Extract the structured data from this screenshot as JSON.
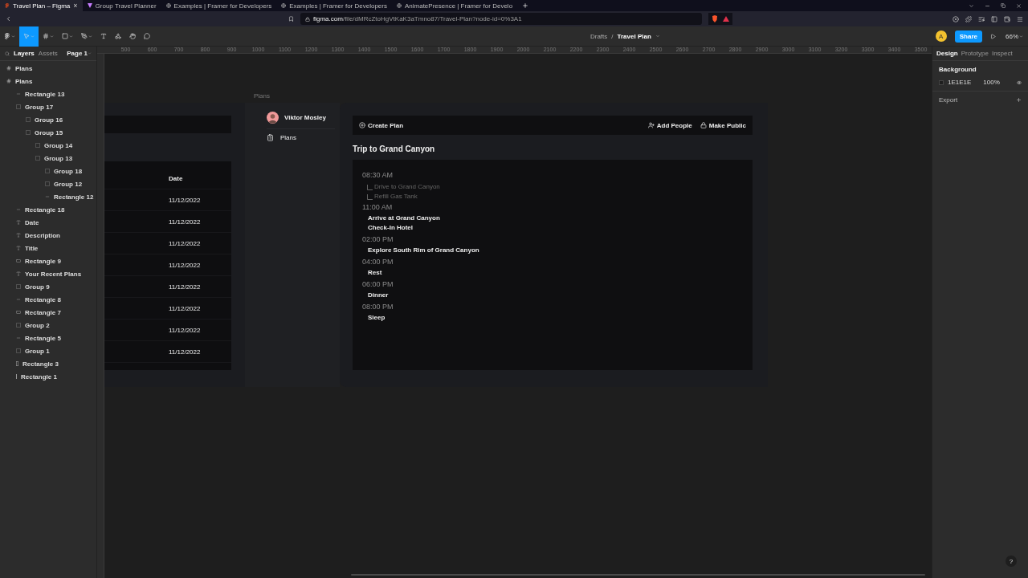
{
  "browser": {
    "tabs": [
      {
        "title": "Travel Plan – Figma",
        "selected": true,
        "close": "×"
      },
      {
        "title": "Group Travel Planner",
        "selected": false
      },
      {
        "title": "Examples | Framer for Developers",
        "selected": false
      },
      {
        "title": "Examples | Framer for Developers",
        "selected": false
      },
      {
        "title": "AnimatePresence | Framer for Develo",
        "selected": false
      }
    ],
    "url_host": "figma.com",
    "url_path": "/file/dMRcZtoHgVtKaK3aTmno87/Travel-Plan?node-id=0%3A1"
  },
  "toolbar": {
    "breadcrumb": "Drafts",
    "separator": "/",
    "file": "Travel Plan",
    "avatar": "A",
    "share": "Share",
    "zoom": "66%"
  },
  "layers_panel": {
    "tabs": [
      {
        "label": "Layers",
        "selected": true
      },
      {
        "label": "Assets",
        "selected": false
      }
    ],
    "page": "Page 1",
    "layers": [
      {
        "name": "Plans",
        "kind": "frame"
      },
      {
        "name": "Plans",
        "kind": "frame",
        "children": [
          {
            "name": "Rectangle 13",
            "kind": "line"
          },
          {
            "name": "Group 17",
            "kind": "group",
            "children": [
              {
                "name": "Group 16",
                "kind": "group"
              },
              {
                "name": "Group 15",
                "kind": "group",
                "children": [
                  {
                    "name": "Group 14",
                    "kind": "group"
                  },
                  {
                    "name": "Group 13",
                    "kind": "group",
                    "children": [
                      {
                        "name": "Group 18",
                        "kind": "group"
                      },
                      {
                        "name": "Group 12",
                        "kind": "group"
                      },
                      {
                        "name": "Rectangle 12",
                        "kind": "line"
                      }
                    ]
                  }
                ]
              }
            ]
          },
          {
            "name": "Rectangle 18",
            "kind": "line"
          },
          {
            "name": "Date",
            "kind": "text"
          },
          {
            "name": "Description",
            "kind": "text"
          },
          {
            "name": "Title",
            "kind": "text"
          },
          {
            "name": "Rectangle 9",
            "kind": "rect"
          },
          {
            "name": "Your Recent Plans",
            "kind": "text"
          },
          {
            "name": "Group 9",
            "kind": "group"
          },
          {
            "name": "Rectangle 8",
            "kind": "line"
          },
          {
            "name": "Rectangle 7",
            "kind": "rect"
          },
          {
            "name": "Group 2",
            "kind": "group"
          },
          {
            "name": "Rectangle 5",
            "kind": "line"
          },
          {
            "name": "Group 1",
            "kind": "group"
          },
          {
            "name": "Rectangle 3",
            "kind": "vrect"
          },
          {
            "name": "Rectangle 1",
            "kind": "vline"
          }
        ]
      }
    ]
  },
  "ruler_marks": [
    "500",
    "600",
    "700",
    "800",
    "900",
    "1000",
    "1100",
    "1200",
    "1300",
    "1400",
    "1500",
    "1600",
    "1700",
    "1800",
    "1900",
    "2000",
    "2100",
    "2200",
    "2300",
    "2400",
    "2500",
    "2600",
    "2700",
    "2800",
    "2900",
    "3000",
    "3100",
    "3200",
    "3300",
    "3400",
    "3500"
  ],
  "canvas": {
    "frame_label": "Plans",
    "table": {
      "header": "Date",
      "rows": [
        "11/12/2022",
        "11/12/2022",
        "11/12/2022",
        "11/12/2022",
        "11/12/2022",
        "11/12/2022",
        "11/12/2022",
        "11/12/2022"
      ]
    },
    "sidebar": {
      "user": "Viktor Mosley",
      "items": [
        {
          "label": "Plans"
        }
      ]
    },
    "actions": {
      "create": "Create Plan",
      "add_people": "Add People",
      "make_public": "Make Public"
    },
    "plan_title": "Trip to Grand Canyon",
    "schedule": [
      {
        "time": "08:30 AM",
        "items": [
          {
            "text": "Drive to Grand Canyon",
            "kind": "subtask"
          },
          {
            "text": "Refill Gas Tank",
            "kind": "subtask"
          }
        ]
      },
      {
        "time": "11:00 AM",
        "items": [
          {
            "text": "Arrive at Grand Canyon",
            "kind": "task"
          },
          {
            "text": "Check-In Hotel",
            "kind": "task"
          }
        ]
      },
      {
        "time": "02:00 PM",
        "items": [
          {
            "text": "Explore South Rim of Grand Canyon",
            "kind": "task"
          }
        ]
      },
      {
        "time": "04:00 PM",
        "items": [
          {
            "text": "Rest",
            "kind": "task"
          }
        ]
      },
      {
        "time": "06:00 PM",
        "items": [
          {
            "text": "Dinner",
            "kind": "task"
          }
        ]
      },
      {
        "time": "08:00 PM",
        "items": [
          {
            "text": "Sleep",
            "kind": "task"
          }
        ]
      }
    ]
  },
  "design_panel": {
    "tabs": [
      {
        "label": "Design",
        "selected": true
      },
      {
        "label": "Prototype",
        "selected": false
      },
      {
        "label": "Inspect",
        "selected": false
      }
    ],
    "background_title": "Background",
    "color": "1E1E1E",
    "opacity": "100%",
    "export": "Export",
    "help": "?"
  }
}
